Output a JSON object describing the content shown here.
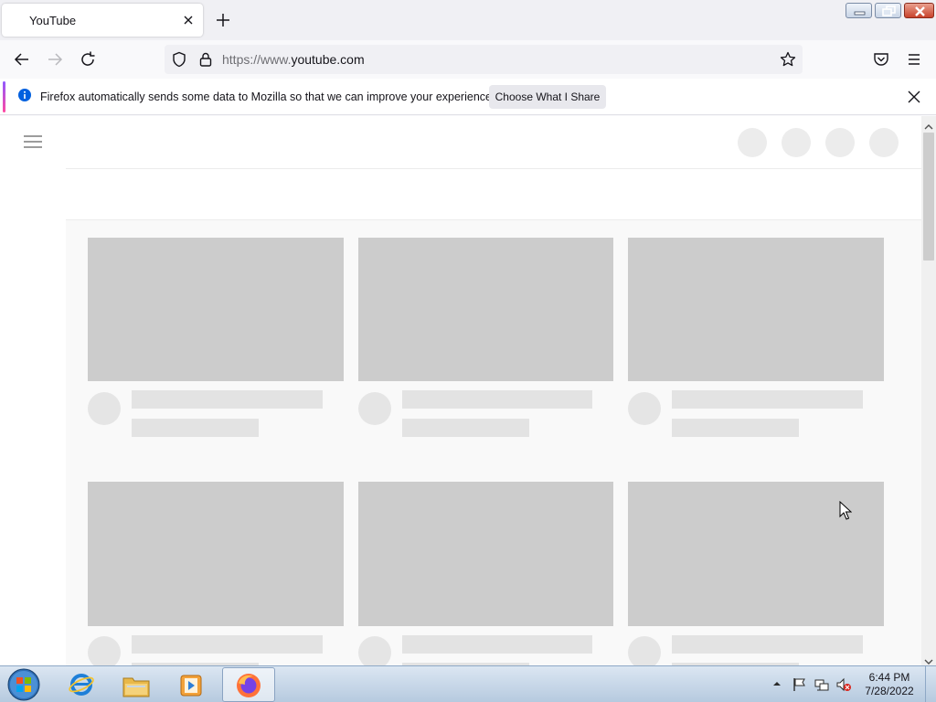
{
  "browser": {
    "tab": {
      "title": "YouTube"
    },
    "url": {
      "prefix": "https://www.",
      "domain": "youtube.com"
    }
  },
  "notification": {
    "message": "Firefox automatically sends some data to Mozilla so that we can improve your experience.",
    "button_label": "Choose What I Share"
  },
  "taskbar": {
    "time": "6:44 PM",
    "date": "7/28/2022"
  }
}
